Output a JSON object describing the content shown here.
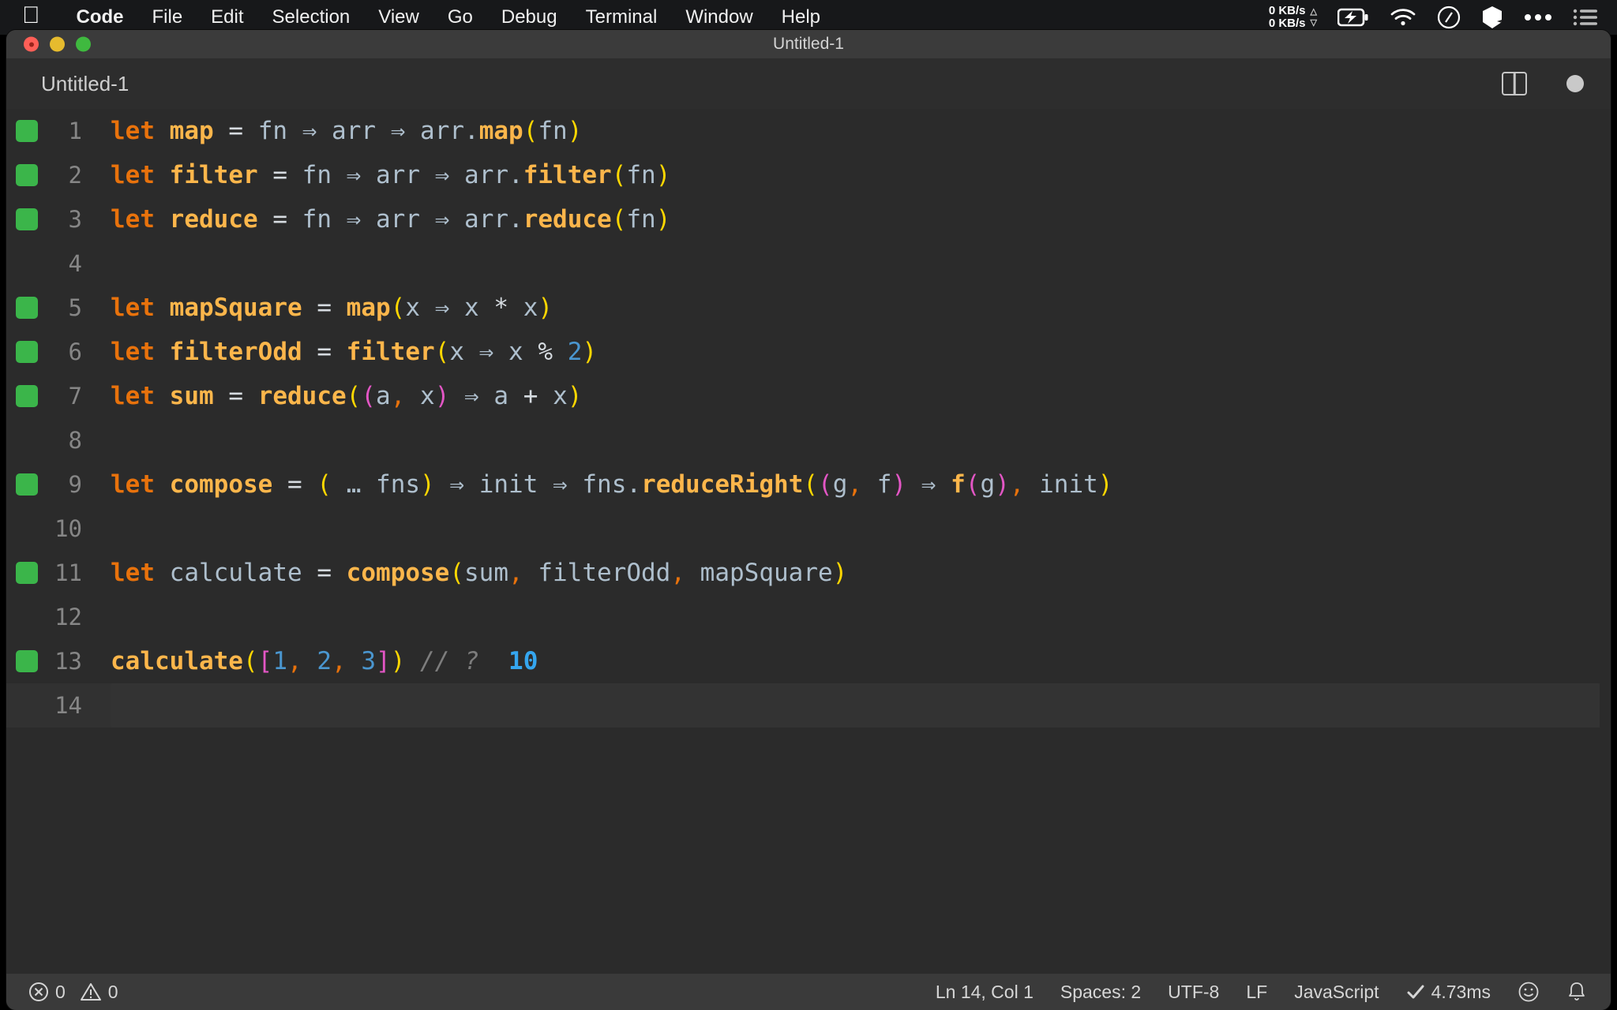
{
  "menubar": {
    "apple_icon": "apple-logo-icon",
    "items": [
      {
        "label": "Code",
        "bold": true
      },
      {
        "label": "File",
        "bold": false
      },
      {
        "label": "Edit",
        "bold": false
      },
      {
        "label": "Selection",
        "bold": false
      },
      {
        "label": "View",
        "bold": false
      },
      {
        "label": "Go",
        "bold": false
      },
      {
        "label": "Debug",
        "bold": false
      },
      {
        "label": "Terminal",
        "bold": false
      },
      {
        "label": "Window",
        "bold": false
      },
      {
        "label": "Help",
        "bold": false
      }
    ],
    "network": {
      "up_rate": "0 KB/s",
      "down_rate": "0 KB/s",
      "up_icon": "triangle-up-icon",
      "down_icon": "triangle-down-icon"
    },
    "icons": [
      "battery-charging-icon",
      "wifi-icon",
      "clock-icon",
      "bartender-icon",
      "ellipsis-icon",
      "control-center-icon"
    ]
  },
  "window": {
    "title": "Untitled-1",
    "traffic_lights": [
      "close-button",
      "minimize-button",
      "zoom-button"
    ]
  },
  "tabbar": {
    "tab_label": "Untitled-1",
    "split_editor_icon": "split-editor-icon",
    "dirty_indicator": "unsaved-changes-dot"
  },
  "editor": {
    "lines": [
      {
        "n": "1",
        "marked": true,
        "current": false
      },
      {
        "n": "2",
        "marked": true,
        "current": false
      },
      {
        "n": "3",
        "marked": true,
        "current": false
      },
      {
        "n": "4",
        "marked": false,
        "current": false
      },
      {
        "n": "5",
        "marked": true,
        "current": false
      },
      {
        "n": "6",
        "marked": true,
        "current": false
      },
      {
        "n": "7",
        "marked": true,
        "current": false
      },
      {
        "n": "8",
        "marked": false,
        "current": false
      },
      {
        "n": "9",
        "marked": true,
        "current": false
      },
      {
        "n": "10",
        "marked": false,
        "current": false
      },
      {
        "n": "11",
        "marked": true,
        "current": false
      },
      {
        "n": "12",
        "marked": false,
        "current": false
      },
      {
        "n": "13",
        "marked": true,
        "current": false
      },
      {
        "n": "14",
        "marked": false,
        "current": true
      }
    ],
    "code_text": [
      "let map = fn ⇒ arr ⇒ arr.map(fn)",
      "let filter = fn ⇒ arr ⇒ arr.filter(fn)",
      "let reduce = fn ⇒ arr ⇒ arr.reduce(fn)",
      "",
      "let mapSquare = map(x ⇒ x * x)",
      "let filterOdd = filter(x ⇒ x % 2)",
      "let sum = reduce((a, x) ⇒ a + x)",
      "",
      "let compose = ( … fns) ⇒ init ⇒ fns.reduceRight((g, f) ⇒ f(g), init)",
      "",
      "let calculate = compose(sum, filterOdd, mapSquare)",
      "",
      "calculate([1, 2, 3]) // ?  10",
      ""
    ],
    "inline_result": "10",
    "language_hint": "JavaScript"
  },
  "statusbar": {
    "errors_icon": "error-circle-icon",
    "errors_count": "0",
    "warnings_icon": "warning-triangle-icon",
    "warnings_count": "0",
    "cursor_position": "Ln 14, Col 1",
    "indentation": "Spaces: 2",
    "encoding": "UTF-8",
    "eol": "LF",
    "language": "JavaScript",
    "runtime_check_icon": "checkmark-icon",
    "runtime": "4.73ms",
    "feedback_icon": "smiley-icon",
    "notifications_icon": "bell-icon"
  },
  "colors": {
    "editor_bg": "#2b2b2b",
    "titlebar_bg": "#3b3b3b",
    "statusbar_bg": "#3a3a3a",
    "keyword": "#e8720c",
    "function": "#fcb64b",
    "identifier": "#aebfcd",
    "number": "#4a96cf",
    "bracket_level1": "#ffd700",
    "bracket_level2": "#e356c5",
    "comment": "#7d7d7d",
    "coverage_marker": "#3bb54a",
    "inline_value": "#35a6ef"
  }
}
